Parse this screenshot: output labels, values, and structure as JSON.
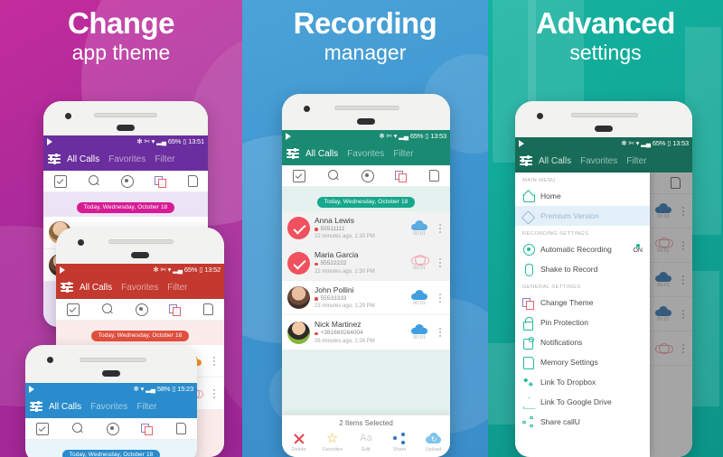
{
  "panels": [
    {
      "title": "Change",
      "subtitle": "app theme",
      "bg": "#ad2a9a"
    },
    {
      "title": "Recording",
      "subtitle": "manager",
      "bg": "#3d94cf"
    },
    {
      "title": "Advanced",
      "subtitle": "settings",
      "bg": "#10a293"
    }
  ],
  "app": {
    "tabs": {
      "all_calls": "All Calls",
      "favorites": "Favorites",
      "filter": "Filter"
    },
    "date_chip": "Today, Wednesday, October 18",
    "tool_icons": [
      "select-icon",
      "search-icon",
      "record-icon",
      "theme-icon",
      "sdcard-icon"
    ]
  },
  "themes": {
    "purple": {
      "name": "purple",
      "color": "#6b2e9e",
      "chip": "#d81b94",
      "tint": "#ece3f5",
      "time": "13:51",
      "battery": "65%"
    },
    "red": {
      "name": "red",
      "color": "#c3392f",
      "chip": "#e0503f",
      "tint": "#fbeceb",
      "time": "13:52",
      "battery": "65%"
    },
    "blue": {
      "name": "blue",
      "color": "#2a8ccc",
      "chip": "#2a8ccc",
      "tint": "#e9f4fb",
      "time": "15:23",
      "battery": "58%"
    },
    "green": {
      "name": "green",
      "color": "#1a8a72",
      "chip": "#17a78c",
      "tint": "#e4f1ee",
      "time": "13:53",
      "battery": "65%"
    },
    "darkgreen": {
      "name": "dark-green",
      "color": "#176b57",
      "chip": "#17a78c",
      "tint": "#e4f1ee",
      "time": "13:53",
      "battery": "65%"
    }
  },
  "statusbar": {
    "bluetooth": "bluetooth-icon",
    "mute": "mute-icon",
    "wifi": "wifi-icon",
    "signal": "signal-icon",
    "battery_icon": "battery-icon"
  },
  "calls": [
    {
      "name": "Anna Lewis",
      "phone": "55511111",
      "ago": "22 minutes ago, 1:30 PM",
      "duration": "00:01",
      "selected": true,
      "cloud": "filled",
      "avatar": "check"
    },
    {
      "name": "Maria Garcia",
      "phone": "55522222",
      "ago": "22 minutes ago, 1:30 PM",
      "duration": "00:01",
      "selected": true,
      "cloud": "outline",
      "avatar": "check"
    },
    {
      "name": "John Pollini",
      "phone": "55533333",
      "ago": "23 minutes ago, 1:29 PM",
      "duration": "00:01",
      "selected": false,
      "cloud": "filled",
      "avatar": "photo-1"
    },
    {
      "name": "Nick Martinez",
      "phone": "+381669264004",
      "ago": "26 minutes ago, 1:26 PM",
      "duration": "00:01",
      "selected": false,
      "cloud": "filled",
      "avatar": "photo-2"
    }
  ],
  "selection_bar": {
    "count_label": "2 Items Selected",
    "actions": [
      {
        "label": "Delete",
        "icon": "close-icon"
      },
      {
        "label": "Favorites",
        "icon": "star-icon"
      },
      {
        "label": "Edit",
        "icon": "text-edit-icon"
      },
      {
        "label": "Share",
        "icon": "share-icon"
      },
      {
        "label": "Upload",
        "icon": "cloud-upload-icon"
      }
    ]
  },
  "drawer": {
    "sections": [
      {
        "title": "MAIN MENU",
        "items": [
          {
            "label": "Home",
            "icon": "home-icon",
            "highlighted": false,
            "toggle": null
          },
          {
            "label": "Premium Version",
            "icon": "diamond-icon",
            "highlighted": true,
            "toggle": null
          }
        ]
      },
      {
        "title": "RECORDING SETTINGS",
        "items": [
          {
            "label": "Automatic Recording",
            "icon": "record-icon",
            "highlighted": false,
            "toggle": "ON"
          },
          {
            "label": "Shake to Record",
            "icon": "shake-icon",
            "highlighted": false,
            "toggle": null
          }
        ]
      },
      {
        "title": "GENERAL SETTINGS",
        "items": [
          {
            "label": "Change Theme",
            "icon": "theme-icon",
            "highlighted": false,
            "toggle": null
          },
          {
            "label": "Pin Protection",
            "icon": "lock-icon",
            "highlighted": false,
            "toggle": null
          },
          {
            "label": "Notifications",
            "icon": "notification-icon",
            "highlighted": false,
            "toggle": null
          },
          {
            "label": "Memory Settings",
            "icon": "sdcard-icon",
            "highlighted": false,
            "toggle": null
          },
          {
            "label": "Link To Dropbox",
            "icon": "dropbox-icon",
            "highlighted": false,
            "toggle": null
          },
          {
            "label": "Link To Google Drive",
            "icon": "gdrive-icon",
            "highlighted": false,
            "toggle": null
          },
          {
            "label": "Share callU",
            "icon": "share-icon",
            "highlighted": false,
            "toggle": null
          }
        ]
      }
    ]
  }
}
